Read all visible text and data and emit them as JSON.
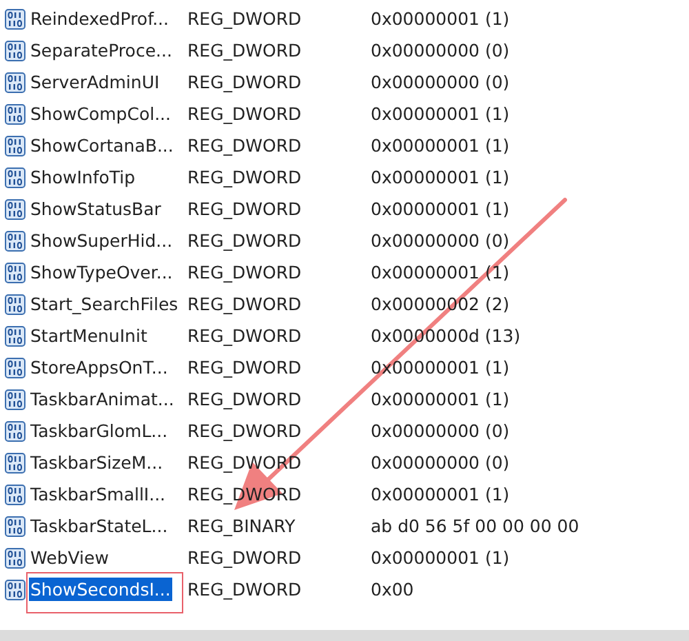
{
  "rows": [
    {
      "name": "ReindexedProf...",
      "type": "REG_DWORD",
      "value": "0x00000001 (1)",
      "selected": false
    },
    {
      "name": "SeparateProce...",
      "type": "REG_DWORD",
      "value": "0x00000000 (0)",
      "selected": false
    },
    {
      "name": "ServerAdminUI",
      "type": "REG_DWORD",
      "value": "0x00000000 (0)",
      "selected": false
    },
    {
      "name": "ShowCompCol...",
      "type": "REG_DWORD",
      "value": "0x00000001 (1)",
      "selected": false
    },
    {
      "name": "ShowCortanaB...",
      "type": "REG_DWORD",
      "value": "0x00000001 (1)",
      "selected": false
    },
    {
      "name": "ShowInfoTip",
      "type": "REG_DWORD",
      "value": "0x00000001 (1)",
      "selected": false
    },
    {
      "name": "ShowStatusBar",
      "type": "REG_DWORD",
      "value": "0x00000001 (1)",
      "selected": false
    },
    {
      "name": "ShowSuperHid...",
      "type": "REG_DWORD",
      "value": "0x00000000 (0)",
      "selected": false
    },
    {
      "name": "ShowTypeOver...",
      "type": "REG_DWORD",
      "value": "0x00000001 (1)",
      "selected": false
    },
    {
      "name": "Start_SearchFiles",
      "type": "REG_DWORD",
      "value": "0x00000002 (2)",
      "selected": false
    },
    {
      "name": "StartMenuInit",
      "type": "REG_DWORD",
      "value": "0x0000000d (13)",
      "selected": false
    },
    {
      "name": "StoreAppsOnT...",
      "type": "REG_DWORD",
      "value": "0x00000001 (1)",
      "selected": false
    },
    {
      "name": "TaskbarAnimat...",
      "type": "REG_DWORD",
      "value": "0x00000001 (1)",
      "selected": false
    },
    {
      "name": "TaskbarGlomL...",
      "type": "REG_DWORD",
      "value": "0x00000000 (0)",
      "selected": false
    },
    {
      "name": "TaskbarSizeM...",
      "type": "REG_DWORD",
      "value": "0x00000000 (0)",
      "selected": false
    },
    {
      "name": "TaskbarSmallI...",
      "type": "REG_DWORD",
      "value": "0x00000001 (1)",
      "selected": false
    },
    {
      "name": "TaskbarStateL...",
      "type": "REG_BINARY",
      "value": "ab d0 56 5f 00 00 00 00",
      "selected": false
    },
    {
      "name": "WebView",
      "type": "REG_DWORD",
      "value": "0x00000001 (1)",
      "selected": false
    },
    {
      "name": "ShowSecondsI...",
      "type": "REG_DWORD",
      "value": "0x00",
      "selected": true,
      "annotated": true
    }
  ]
}
